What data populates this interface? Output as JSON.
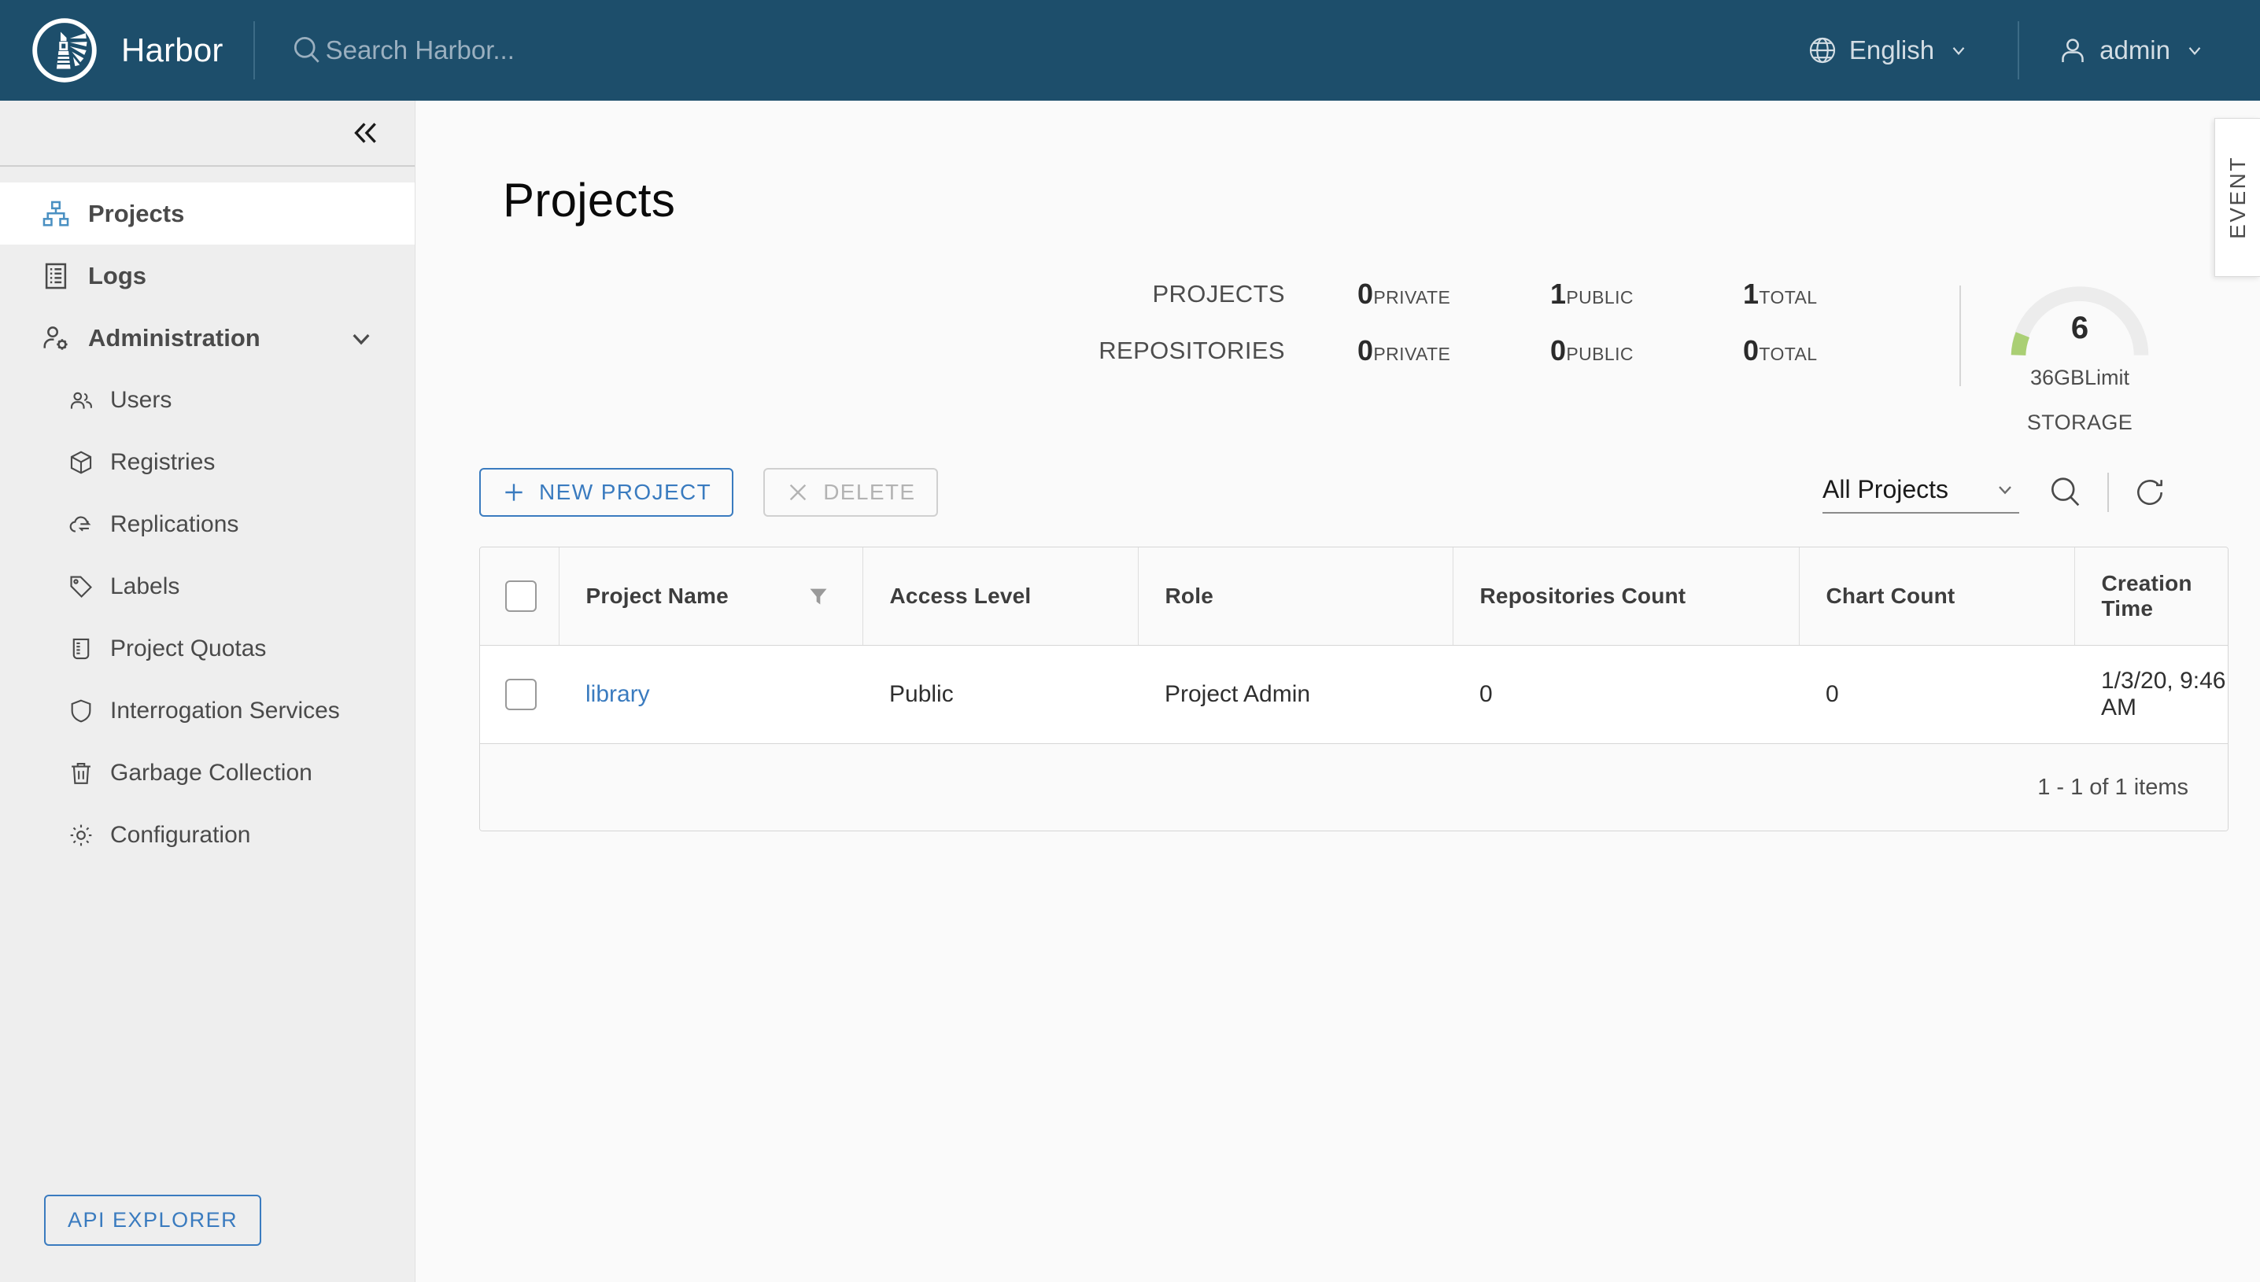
{
  "header": {
    "brand_title": "Harbor",
    "logo_icon": "harbor-lighthouse-logo",
    "search_placeholder": "Search Harbor...",
    "search_value": "",
    "search_icon": "search-icon",
    "language": "English",
    "language_icon": "globe-icon",
    "user": "admin",
    "user_icon": "user-icon",
    "caret_icon": "chevron-down-icon"
  },
  "sidebar": {
    "collapse_icon": "double-chevron-left-icon",
    "items": [
      {
        "label": "Projects",
        "icon": "projects-icon",
        "active": true,
        "level": "top"
      },
      {
        "label": "Logs",
        "icon": "logs-icon",
        "active": false,
        "level": "top"
      },
      {
        "label": "Administration",
        "icon": "administration-icon",
        "active": false,
        "level": "top",
        "expanded": true
      },
      {
        "label": "Users",
        "icon": "users-icon",
        "active": false,
        "level": "sub"
      },
      {
        "label": "Registries",
        "icon": "registries-cube-icon",
        "active": false,
        "level": "sub"
      },
      {
        "label": "Replications",
        "icon": "replications-cloud-icon",
        "active": false,
        "level": "sub"
      },
      {
        "label": "Labels",
        "icon": "labels-tag-icon",
        "active": false,
        "level": "sub"
      },
      {
        "label": "Project Quotas",
        "icon": "project-quotas-beaker-icon",
        "active": false,
        "level": "sub"
      },
      {
        "label": "Interrogation Services",
        "icon": "shield-icon",
        "active": false,
        "level": "sub"
      },
      {
        "label": "Garbage Collection",
        "icon": "trash-icon",
        "active": false,
        "level": "sub"
      },
      {
        "label": "Configuration",
        "icon": "gear-icon",
        "active": false,
        "level": "sub"
      }
    ],
    "api_explorer_label": "API EXPLORER"
  },
  "main": {
    "page_title": "Projects",
    "event_tab_label": "EVENT"
  },
  "statistics": {
    "rows": [
      {
        "label": "PROJECTS",
        "cells": [
          {
            "value": "0",
            "unit": "PRIVATE"
          },
          {
            "value": "1",
            "unit": "PUBLIC"
          },
          {
            "value": "1",
            "unit": "TOTAL"
          }
        ]
      },
      {
        "label": "REPOSITORIES",
        "cells": [
          {
            "value": "0",
            "unit": "PRIVATE"
          },
          {
            "value": "0",
            "unit": "PUBLIC"
          },
          {
            "value": "0",
            "unit": "TOTAL"
          }
        ]
      }
    ],
    "storage": {
      "used": "6",
      "limit": "36GBLimit",
      "caption": "STORAGE",
      "arc_color": "#aacf74",
      "track_color": "#ececec",
      "fill_fraction": 0.17
    }
  },
  "toolbar": {
    "new_project_label": "NEW PROJECT",
    "new_project_icon": "plus-icon",
    "delete_label": "DELETE",
    "delete_icon": "close-x-icon",
    "delete_disabled": true,
    "filter_selected": "All Projects",
    "filter_caret_icon": "chevron-down-icon",
    "search_icon": "search-icon",
    "refresh_icon": "refresh-icon"
  },
  "table": {
    "columns": [
      "Project Name",
      "Access Level",
      "Role",
      "Repositories Count",
      "Chart Count",
      "Creation Time"
    ],
    "filter_icon": "filter-funnel-icon",
    "select_all_checkbox": false,
    "rows": [
      {
        "checked": false,
        "name": "library",
        "access_level": "Public",
        "role": "Project Admin",
        "repositories_count": "0",
        "chart_count": "0",
        "creation_time": "1/3/20, 9:46 AM"
      }
    ],
    "pagination": "1 - 1 of 1 items"
  },
  "colors": {
    "header_bg": "#1d4e6b",
    "accent": "#3a7bbf",
    "sidebar_bg": "#eeeeee",
    "main_bg": "#fafafa",
    "storage_green": "#aacf74"
  }
}
